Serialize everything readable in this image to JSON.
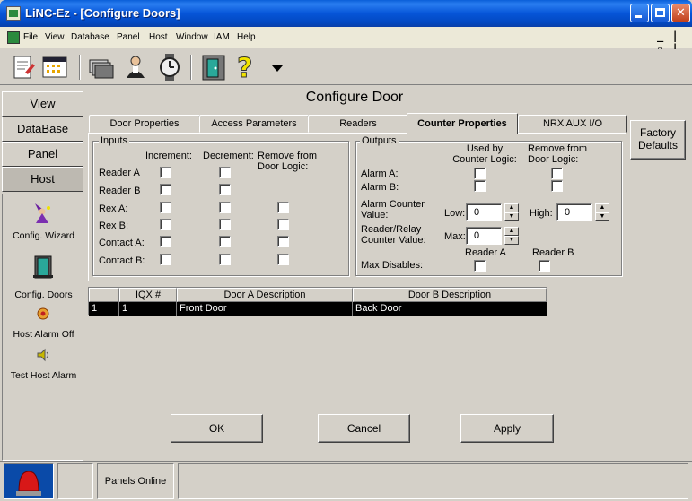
{
  "window": {
    "title": "LiNC-Ez - [Configure Doors]"
  },
  "menu": {
    "items": [
      "File",
      "View",
      "Database",
      "Panel",
      "Host",
      "Window",
      "IAM",
      "Help"
    ],
    "mdi_controls": "_ | ▫ | ×"
  },
  "toolbar": {
    "icons": [
      "document-icon",
      "calendar-icon",
      "cards-icon",
      "person-icon",
      "watch-icon",
      "door-icon",
      "help-icon",
      "dropdown-arrow-icon"
    ]
  },
  "sidebar": {
    "tabs": [
      "View",
      "DataBase",
      "Panel",
      "Host"
    ],
    "items": [
      {
        "label": "Config. Wizard",
        "icon": "wizard-icon"
      },
      {
        "label": "Config. Doors",
        "icon": "door-icon"
      },
      {
        "label": "Host Alarm Off",
        "icon": "alarm-off-icon"
      },
      {
        "label": "Test Host Alarm",
        "icon": "speaker-icon"
      }
    ]
  },
  "main": {
    "title": "Configure Door",
    "tabs": [
      "Door Properties",
      "Access Parameters",
      "Readers",
      "Counter Properties",
      "NRX AUX I/O"
    ],
    "active_tab": "Counter Properties",
    "factory_defaults": "Factory Defaults",
    "inputs": {
      "title": "Inputs",
      "col_increment": "Increment:",
      "col_decrement": "Decrement:",
      "col_remove": "Remove from Door Logic:",
      "rows": [
        "Reader A",
        "Reader B",
        "Rex A:",
        "Rex B:",
        "Contact A:",
        "Contact B:"
      ]
    },
    "outputs": {
      "title": "Outputs",
      "col_used": "Used by Counter Logic:",
      "col_remove": "Remove from Door Logic:",
      "alarm_a": "Alarm A:",
      "alarm_b": "Alarm B:",
      "alarm_counter": "Alarm Counter Value:",
      "relay_counter": "Reader/Relay Counter Value:",
      "low_label": "Low:",
      "low_value": "0",
      "high_label": "High:",
      "high_value": "0",
      "max_label": "Max:",
      "max_value": "0",
      "max_disables": "Max Disables:",
      "reader_a": "Reader A",
      "reader_b": "Reader B"
    },
    "grid": {
      "headers": [
        "",
        "IQX #",
        "Door A Description",
        "Door B Description"
      ],
      "rows": [
        {
          "num": "1",
          "iqx": "1",
          "door_a": "Front Door",
          "door_b": "Back Door"
        }
      ]
    },
    "buttons": {
      "ok": "OK",
      "cancel": "Cancel",
      "apply": "Apply"
    }
  },
  "status": {
    "panels_online": "Panels Online"
  }
}
